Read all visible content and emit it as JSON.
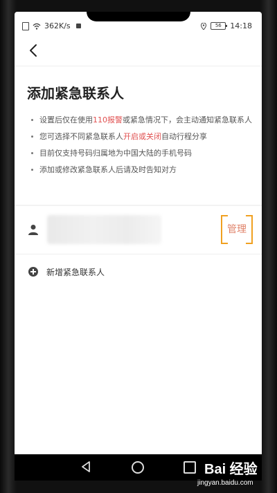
{
  "status_bar": {
    "speed": "362K/s",
    "battery": "56",
    "time": "14:18"
  },
  "page": {
    "title": "添加紧急联系人"
  },
  "bullets": [
    {
      "pre": "设置后仅在使用",
      "highlight": "110报警",
      "post": "或紧急情况下，会主动通知紧急联系人"
    },
    {
      "pre": "您可选择不同紧急联系人",
      "highlight": "开启或关闭",
      "post": "自动行程分享"
    },
    {
      "pre": "目前仅支持号码归属地为中国大陆的手机号码",
      "highlight": "",
      "post": ""
    },
    {
      "pre": "添加或修改紧急联系人后请及时告知对方",
      "highlight": "",
      "post": ""
    }
  ],
  "contact": {
    "manage_label": "管理"
  },
  "add_contact": {
    "label": "新增紧急联系人"
  },
  "watermark": {
    "logo": "Bai 经验",
    "url": "jingyan.baidu.com"
  },
  "colors": {
    "highlight": "#e05050",
    "manage_text": "#e0836a",
    "focus_corner": "#f0a020"
  },
  "icons": [
    "sim-icon",
    "wifi-icon",
    "stop-icon",
    "location-icon",
    "battery-icon",
    "back-arrow-icon",
    "person-icon",
    "add-circle-icon",
    "nav-back-icon",
    "nav-home-icon",
    "nav-recent-icon"
  ]
}
